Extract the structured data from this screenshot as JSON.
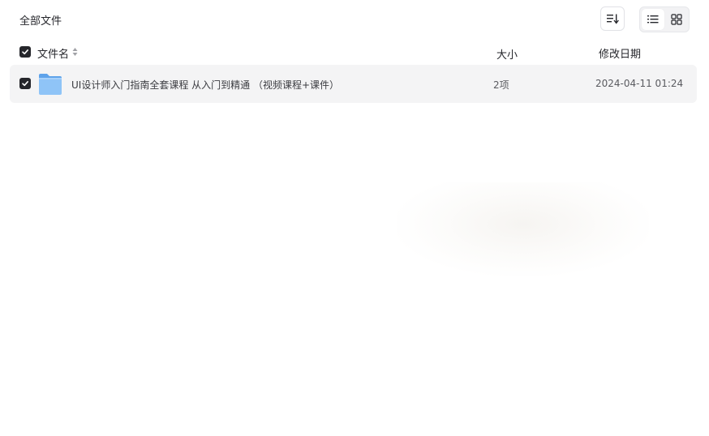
{
  "header": {
    "breadcrumb": "全部文件",
    "sort_icon": "sort-list-icon",
    "view_list_icon": "list-view-icon",
    "view_grid_icon": "grid-view-icon"
  },
  "columns": {
    "name": "文件名",
    "size": "大小",
    "date": "修改日期"
  },
  "files": [
    {
      "name": "UI设计师入门指南全套课程 从入门到精通 （视频课程+课件）",
      "size": "2项",
      "modified": "2024-04-11 01:24",
      "type_icon": "folder-icon",
      "selected": true
    }
  ],
  "colors": {
    "checkbox": "#25262b",
    "folder": "#7ab8f5",
    "row_bg": "#f4f4f5"
  }
}
